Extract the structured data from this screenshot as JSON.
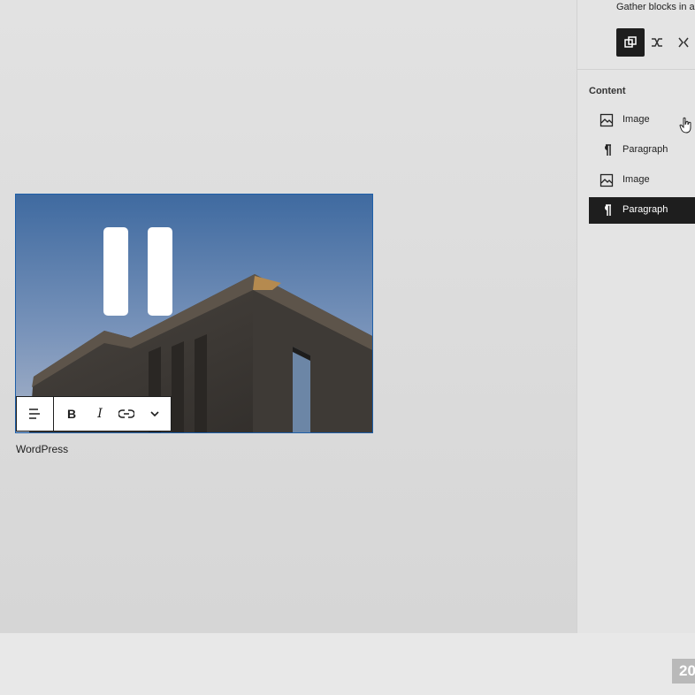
{
  "sidebar": {
    "description": "Gather blocks in a",
    "tools": [
      {
        "icon": "group-icon",
        "active": true
      },
      {
        "icon": "shuffle-icon",
        "active": false
      },
      {
        "icon": "ungroup-icon",
        "active": false
      }
    ],
    "content_heading": "Content",
    "items": [
      {
        "icon": "image-icon",
        "label": "Image"
      },
      {
        "icon": "paragraph-icon",
        "label": "Paragraph"
      },
      {
        "icon": "image-icon",
        "label": "Image"
      },
      {
        "icon": "paragraph-icon",
        "label": "Paragraph",
        "selected": true
      }
    ]
  },
  "editor": {
    "caption": "WordPress",
    "toolbar": {
      "align_icon": "align-left-icon",
      "bold_label": "B",
      "italic_label": "I",
      "link_icon": "link-icon",
      "more_icon": "chevron-down-icon"
    },
    "overlay_icon": "pause-icon"
  },
  "footer": {
    "year_badge": "20"
  },
  "colors": {
    "selected_bg": "#1e1e1e",
    "canvas_bg": "#dcdcdc",
    "sky": "#4a6f9e"
  }
}
